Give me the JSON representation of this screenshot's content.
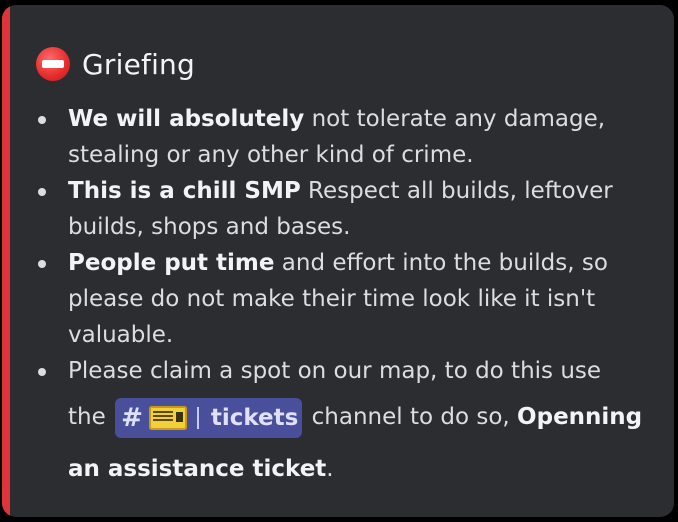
{
  "embed": {
    "accent_color": "#e0343b",
    "title_icon": "no-entry-icon",
    "title": "Griefing",
    "rules": [
      {
        "bold": "We will absolutely",
        "text": " not tolerate any damage, stealing or any other kind of crime."
      },
      {
        "bold": "This is a chill SMP",
        "text": " Respect all builds, leftover builds, shops and bases."
      },
      {
        "bold": "People put time",
        "text": " and effort into the builds, so please do not make their time look like it isn't valuable."
      },
      {
        "text_line1": "Please claim a spot on our map, to do this use",
        "text_before": "the ",
        "channel": {
          "hash_icon": "hash-icon",
          "emoji_icon": "ticket-icon",
          "name": "tickets"
        },
        "text_after": " channel to do so, ",
        "bold_a": "Openning",
        "bold_b": "an assistance ticket",
        "end": "."
      }
    ]
  }
}
